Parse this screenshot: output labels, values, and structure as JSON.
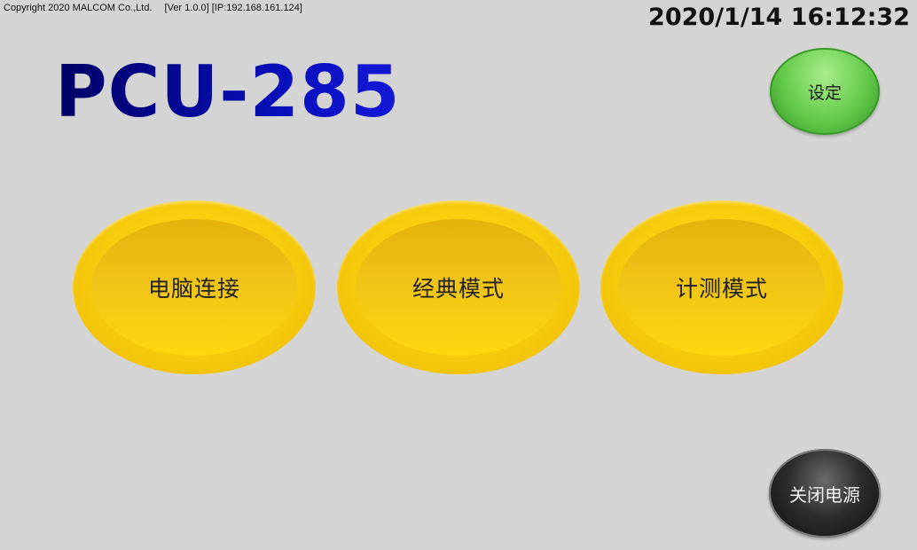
{
  "header": {
    "copyright": "Copyright 2020 MALCOM Co.,Ltd.",
    "version_info": "[Ver 1.0.0] [IP:192.168.161.124]",
    "datetime": "2020/1/14 16:12:32"
  },
  "title": "PCU-285",
  "buttons": {
    "settings": "设定",
    "pc_connect": "电脑连接",
    "classic_mode": "经典模式",
    "measure_mode": "计测模式",
    "power_off": "关闭电源"
  },
  "colors": {
    "background": "#d4d4d4",
    "title": "#0a10c0",
    "mode_button": "#f7cc0c",
    "settings_button": "#62c948",
    "power_button": "#1a1a1a"
  }
}
